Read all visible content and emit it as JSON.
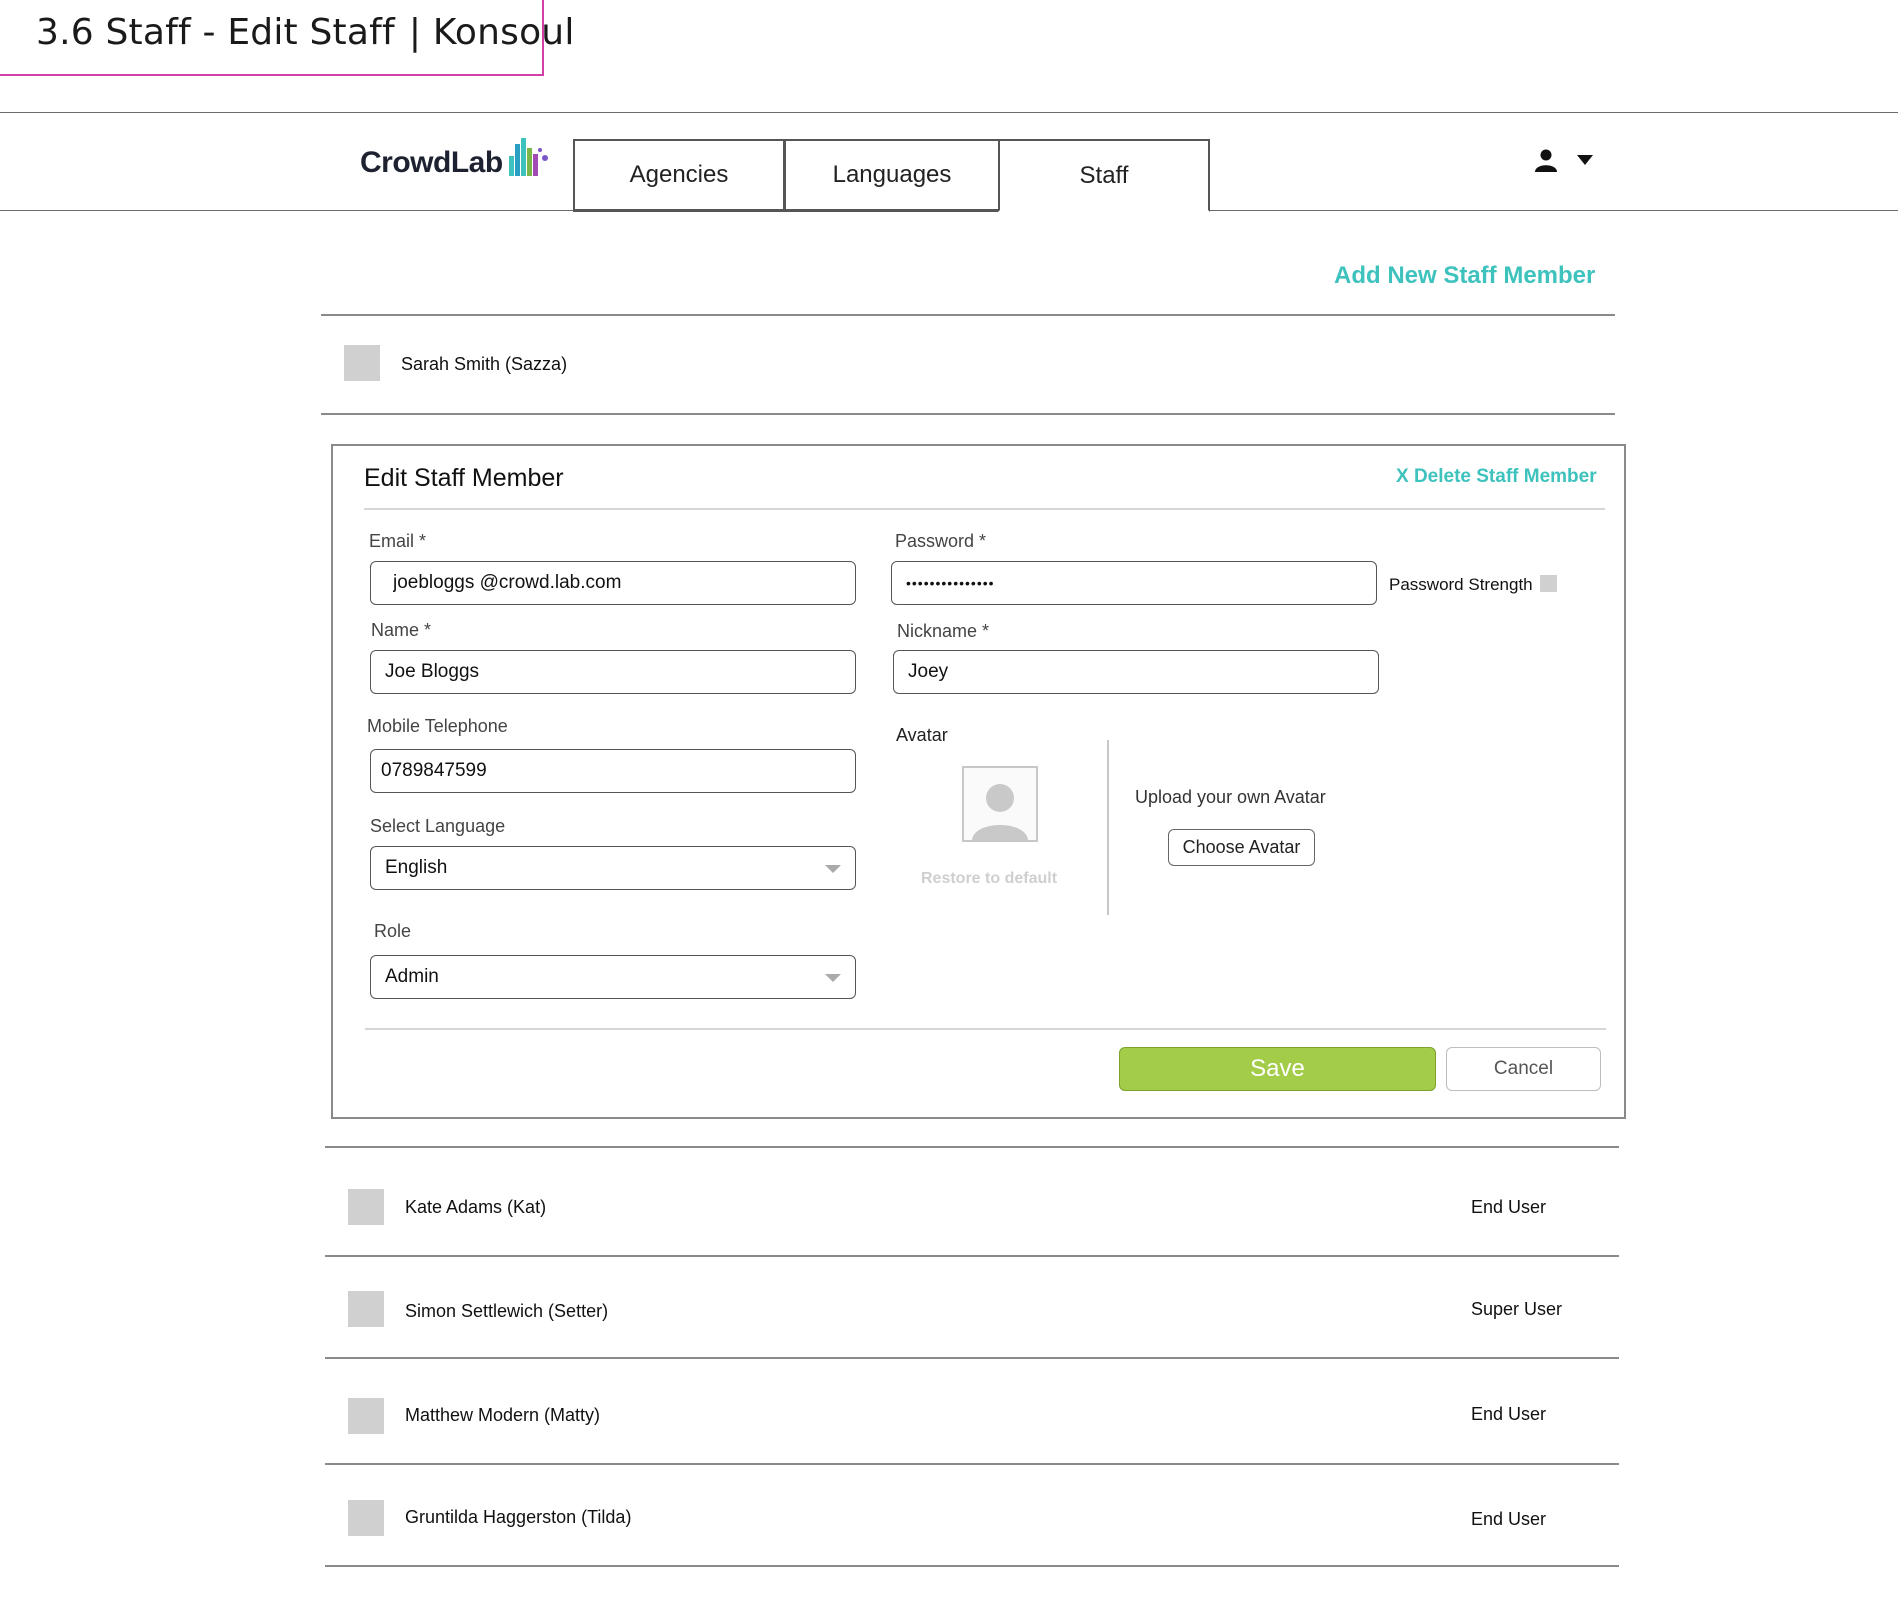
{
  "page_caption": {
    "title": "3.6 Staff - Edit Staff",
    "client": "| Konsoul",
    "accent_color": "#d23fa8"
  },
  "header": {
    "logo_text": "CrowdLab",
    "tabs": [
      {
        "label": "Agencies",
        "active": false
      },
      {
        "label": "Languages",
        "active": false
      },
      {
        "label": "Staff",
        "active": true
      }
    ],
    "user_icon": "user-icon",
    "dropdown_icon": "caret-down-icon"
  },
  "toolbar": {
    "add_staff_label": "Add New Staff Member",
    "accent_color": "#3ec2bd"
  },
  "selected_staff": {
    "name": "Sarah Smith (Sazza)"
  },
  "edit_form": {
    "title": "Edit Staff Member",
    "delete_label": "X Delete Staff Member",
    "email": {
      "label": "Email *",
      "value": "joebloggs @crowd.lab.com"
    },
    "password": {
      "label": "Password *",
      "value": "•••••••••••••••"
    },
    "password_strength_label": "Password Strength",
    "name": {
      "label": "Name *",
      "value": "Joe Bloggs"
    },
    "nickname": {
      "label": "Nickname *",
      "value": "Joey"
    },
    "mobile": {
      "label": "Mobile Telephone",
      "value": "0789847599"
    },
    "language": {
      "label": "Select Language",
      "value": "English"
    },
    "role": {
      "label": "Role",
      "value": "Admin"
    },
    "avatar": {
      "label": "Avatar",
      "restore_label": "Restore to default",
      "upload_label": "Upload your own Avatar",
      "choose_label": "Choose Avatar"
    },
    "save_label": "Save",
    "cancel_label": "Cancel",
    "save_color": "#a3cc48"
  },
  "staff_list": [
    {
      "name": "Kate Adams (Kat)",
      "role": "End User"
    },
    {
      "name": "Simon Settlewich (Setter)",
      "role": "Super User"
    },
    {
      "name": "Matthew Modern (Matty)",
      "role": "End User"
    },
    {
      "name": "Gruntilda Haggerston (Tilda)",
      "role": "End User"
    }
  ]
}
